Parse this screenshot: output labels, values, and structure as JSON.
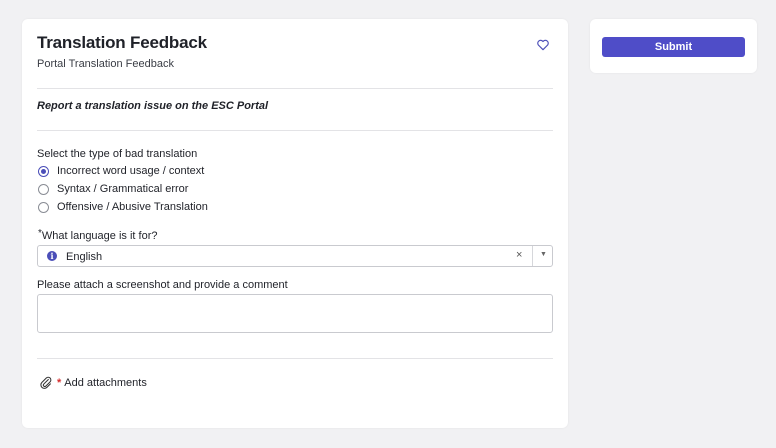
{
  "form": {
    "title": "Translation Feedback",
    "subtitle": "Portal Translation Feedback",
    "description": "Report a translation issue on the ESC Portal",
    "favorite_icon": "heart-outline-icon"
  },
  "question_type": {
    "label": "Select the type of bad translation",
    "options": [
      {
        "label": "Incorrect word usage / context",
        "checked": true
      },
      {
        "label": "Syntax / Grammatical error",
        "checked": false
      },
      {
        "label": "Offensive / Abusive Translation",
        "checked": false
      }
    ]
  },
  "question_language": {
    "required_mark": "*",
    "label": "What language is it for?",
    "info_glyph": "i",
    "value": "English",
    "clear_glyph": "×",
    "caret_glyph": "▼"
  },
  "question_comment": {
    "label": "Please attach a screenshot and provide a comment",
    "value": ""
  },
  "attachments": {
    "required_mark": "*",
    "label": "Add attachments"
  },
  "sidebar": {
    "submit_label": "Submit"
  },
  "colors": {
    "accent": "#4f4dc8",
    "required": "#d62f2f"
  }
}
